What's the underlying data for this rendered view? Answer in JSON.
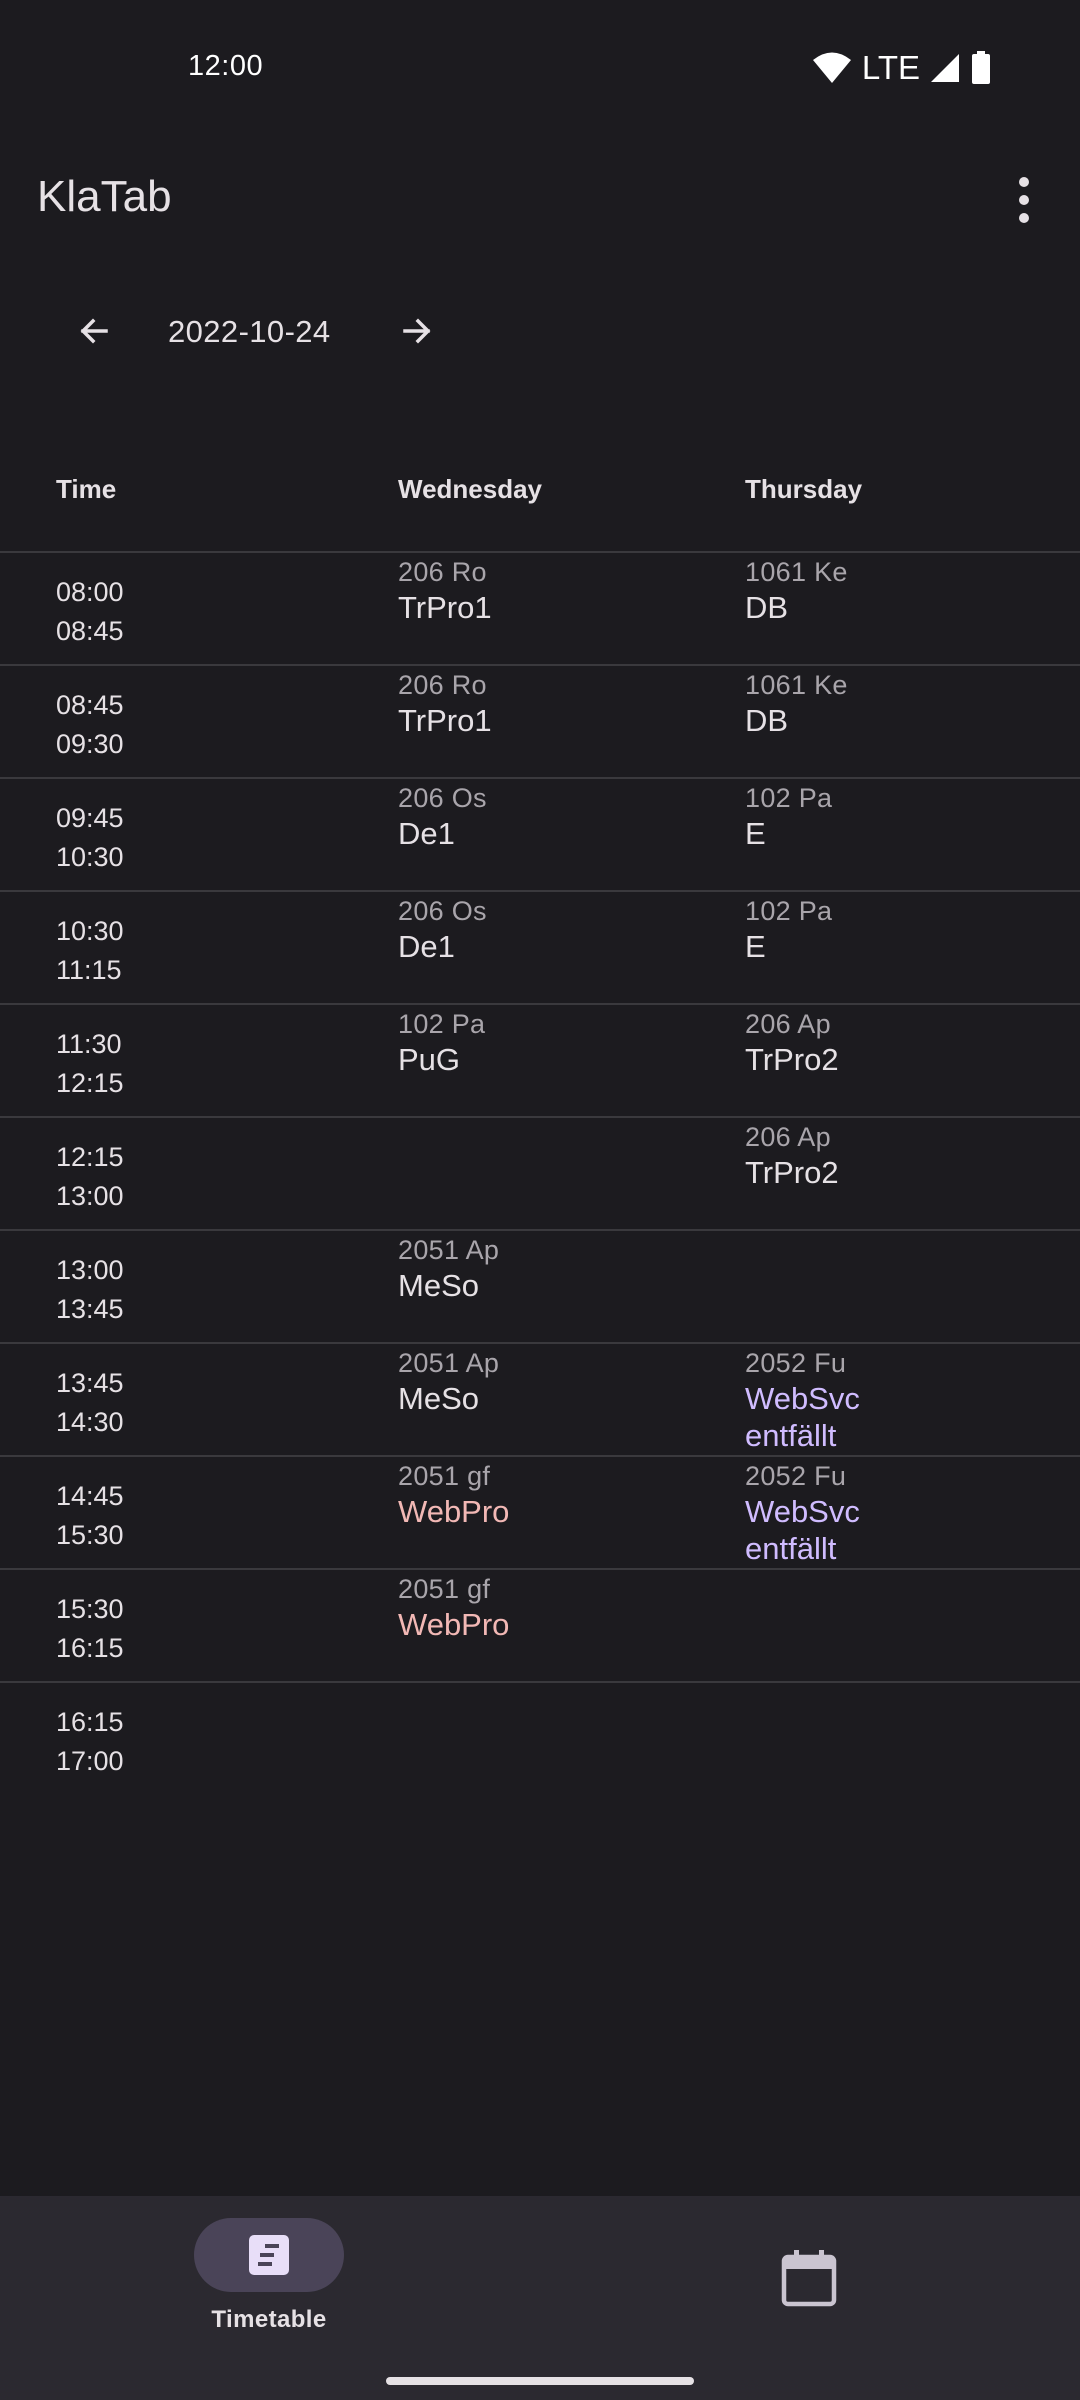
{
  "status_bar": {
    "time": "12:00",
    "network": "LTE",
    "icons": [
      "wifi-icon",
      "signal-icon",
      "battery-icon"
    ]
  },
  "app_bar": {
    "title": "KlaTab",
    "menu_icon": "more-vert-icon"
  },
  "date_nav": {
    "date": "2022-10-24",
    "prev_icon": "arrow-left-icon",
    "next_icon": "arrow-right-icon"
  },
  "table": {
    "headers": [
      "Time",
      "Wednesday",
      "Thursday"
    ],
    "rows": [
      {
        "start": "08:00",
        "end": "08:45",
        "wed": {
          "room": "206 Ro",
          "subject": "TrPro1"
        },
        "thu": {
          "room": "1061 Ke",
          "subject": "DB"
        }
      },
      {
        "start": "08:45",
        "end": "09:30",
        "wed": {
          "room": "206 Ro",
          "subject": "TrPro1"
        },
        "thu": {
          "room": "1061 Ke",
          "subject": "DB"
        }
      },
      {
        "start": "09:45",
        "end": "10:30",
        "wed": {
          "room": "206 Os",
          "subject": "De1"
        },
        "thu": {
          "room": "102 Pa",
          "subject": "E"
        }
      },
      {
        "start": "10:30",
        "end": "11:15",
        "wed": {
          "room": "206 Os",
          "subject": "De1"
        },
        "thu": {
          "room": "102 Pa",
          "subject": "E"
        }
      },
      {
        "start": "11:30",
        "end": "12:15",
        "wed": {
          "room": "102 Pa",
          "subject": "PuG"
        },
        "thu": {
          "room": "206 Ap",
          "subject": "TrPro2"
        }
      },
      {
        "start": "12:15",
        "end": "13:00",
        "wed": null,
        "thu": {
          "room": "206 Ap",
          "subject": "TrPro2"
        }
      },
      {
        "start": "13:00",
        "end": "13:45",
        "wed": {
          "room": "2051 Ap",
          "subject": "MeSo"
        },
        "thu": null
      },
      {
        "start": "13:45",
        "end": "14:30",
        "wed": {
          "room": "2051 Ap",
          "subject": "MeSo"
        },
        "thu": {
          "room": "2052 Fu",
          "subject": "WebSvc",
          "note": "entfällt"
        }
      },
      {
        "start": "14:45",
        "end": "15:30",
        "wed": {
          "room": "2051 gf",
          "subject": "WebPro"
        },
        "thu": {
          "room": "2052 Fu",
          "subject": "WebSvc",
          "note": "entfällt"
        }
      },
      {
        "start": "15:30",
        "end": "16:15",
        "wed": {
          "room": "2051 gf",
          "subject": "WebPro"
        },
        "thu": null
      },
      {
        "start": "16:15",
        "end": "17:00",
        "wed": null,
        "thu": null
      }
    ]
  },
  "colors": {
    "background": "#1c1b1f",
    "changed_subject": "#f2b8b5",
    "cancelled_subject": "#d0bcff",
    "divider": "#3a393d"
  },
  "bottom_nav": {
    "timetable_label": "Timetable",
    "timetable_icon": "timetable-icon",
    "calendar_icon": "calendar-icon"
  }
}
